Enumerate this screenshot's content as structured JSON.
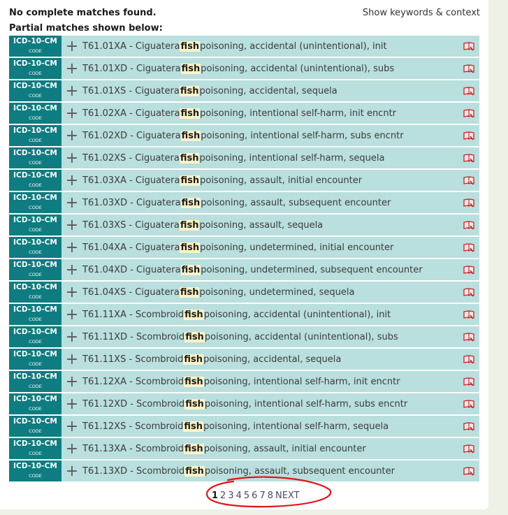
{
  "header": {
    "no_match": "No complete matches found.",
    "partial": "Partial matches shown below:",
    "show_keywords": "Show keywords & context"
  },
  "badge": {
    "top": "ICD-10-CM",
    "bottom": "CODE"
  },
  "highlight_word": "fish",
  "rows": [
    {
      "pre": "T61.01XA - Ciguatera ",
      "post": " poisoning, accidental (unintentional), init"
    },
    {
      "pre": "T61.01XD - Ciguatera ",
      "post": " poisoning, accidental (unintentional), subs"
    },
    {
      "pre": "T61.01XS - Ciguatera ",
      "post": " poisoning, accidental, sequela"
    },
    {
      "pre": "T61.02XA - Ciguatera ",
      "post": " poisoning, intentional self-harm, init encntr"
    },
    {
      "pre": "T61.02XD - Ciguatera ",
      "post": " poisoning, intentional self-harm, subs encntr"
    },
    {
      "pre": "T61.02XS - Ciguatera ",
      "post": " poisoning, intentional self-harm, sequela"
    },
    {
      "pre": "T61.03XA - Ciguatera ",
      "post": " poisoning, assault, initial encounter"
    },
    {
      "pre": "T61.03XD - Ciguatera ",
      "post": " poisoning, assault, subsequent encounter"
    },
    {
      "pre": "T61.03XS - Ciguatera ",
      "post": " poisoning, assault, sequela"
    },
    {
      "pre": "T61.04XA - Ciguatera ",
      "post": " poisoning, undetermined, initial encounter"
    },
    {
      "pre": "T61.04XD - Ciguatera ",
      "post": " poisoning, undetermined, subsequent encounter"
    },
    {
      "pre": "T61.04XS - Ciguatera ",
      "post": " poisoning, undetermined, sequela"
    },
    {
      "pre": "T61.11XA - Scombroid ",
      "post": " poisoning, accidental (unintentional), init"
    },
    {
      "pre": "T61.11XD - Scombroid ",
      "post": " poisoning, accidental (unintentional), subs"
    },
    {
      "pre": "T61.11XS - Scombroid ",
      "post": " poisoning, accidental, sequela"
    },
    {
      "pre": "T61.12XA - Scombroid ",
      "post": " poisoning, intentional self-harm, init encntr"
    },
    {
      "pre": "T61.12XD - Scombroid ",
      "post": " poisoning, intentional self-harm, subs encntr"
    },
    {
      "pre": "T61.12XS - Scombroid ",
      "post": " poisoning, intentional self-harm, sequela"
    },
    {
      "pre": "T61.13XA - Scombroid ",
      "post": " poisoning, assault, initial encounter"
    },
    {
      "pre": "T61.13XD - Scombroid ",
      "post": " poisoning, assault, subsequent encounter"
    }
  ],
  "pagination": {
    "current": "1",
    "pages": [
      "2",
      "3",
      "4",
      "5",
      "6",
      "7",
      "8"
    ],
    "next": "NEXT"
  },
  "colors": {
    "badge_bg": "#0e7c80",
    "row_bg": "#b9dfde",
    "highlight_bg": "#fcf3c8",
    "annotation_circle": "#e0141b"
  }
}
